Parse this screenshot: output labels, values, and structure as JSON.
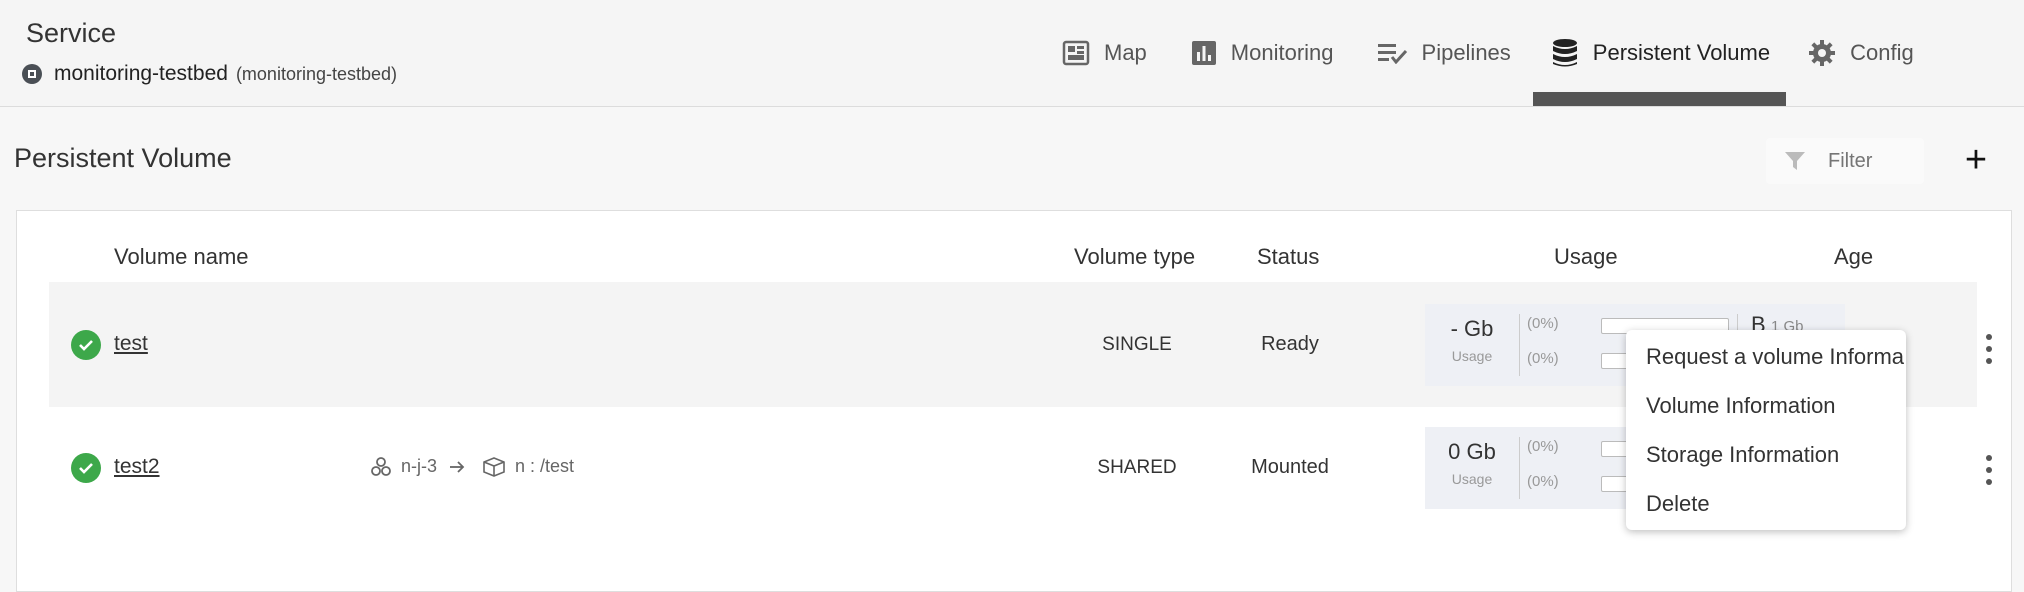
{
  "header": {
    "title": "Service",
    "service_name": "monitoring-testbed",
    "service_sub": "(monitoring-testbed)",
    "service_icon": "service-badge-icon"
  },
  "tabs": [
    {
      "label": "Map",
      "icon": "map-icon",
      "active": false
    },
    {
      "label": "Monitoring",
      "icon": "bar-chart-icon",
      "active": false
    },
    {
      "label": "Pipelines",
      "icon": "pipeline-list-icon",
      "active": false
    },
    {
      "label": "Persistent Volume",
      "icon": "database-icon",
      "active": true
    },
    {
      "label": "Config",
      "icon": "gear-icon",
      "active": false
    }
  ],
  "page": {
    "title": "Persistent Volume",
    "filter_placeholder": "Filter",
    "add_label": "+"
  },
  "table": {
    "headers": {
      "name": "Volume name",
      "type": "Volume type",
      "status": "Status",
      "usage": "Usage",
      "age": "Age"
    },
    "rows": [
      {
        "name": "test",
        "type": "SINGLE",
        "status": "Ready",
        "usage_value": "- Gb",
        "usage_label": "Usage",
        "pct1": "(0%)",
        "pct2": "(0%)",
        "right_value": "B",
        "right_sub": "1 Gb"
      },
      {
        "name": "test2",
        "type": "SHARED",
        "status": "Mounted",
        "mount_from": "n-j-3",
        "mount_to": "n : /test",
        "usage_value": "0 Gb",
        "usage_label": "Usage",
        "pct1": "(0%)",
        "pct2": "(0%)"
      }
    ]
  },
  "menu": {
    "items": [
      "Request a volume Informa",
      "Volume Information",
      "Storage Information",
      "Delete"
    ]
  },
  "colors": {
    "ok_green": "#3da84a",
    "active_tab_underline": "#555555"
  }
}
